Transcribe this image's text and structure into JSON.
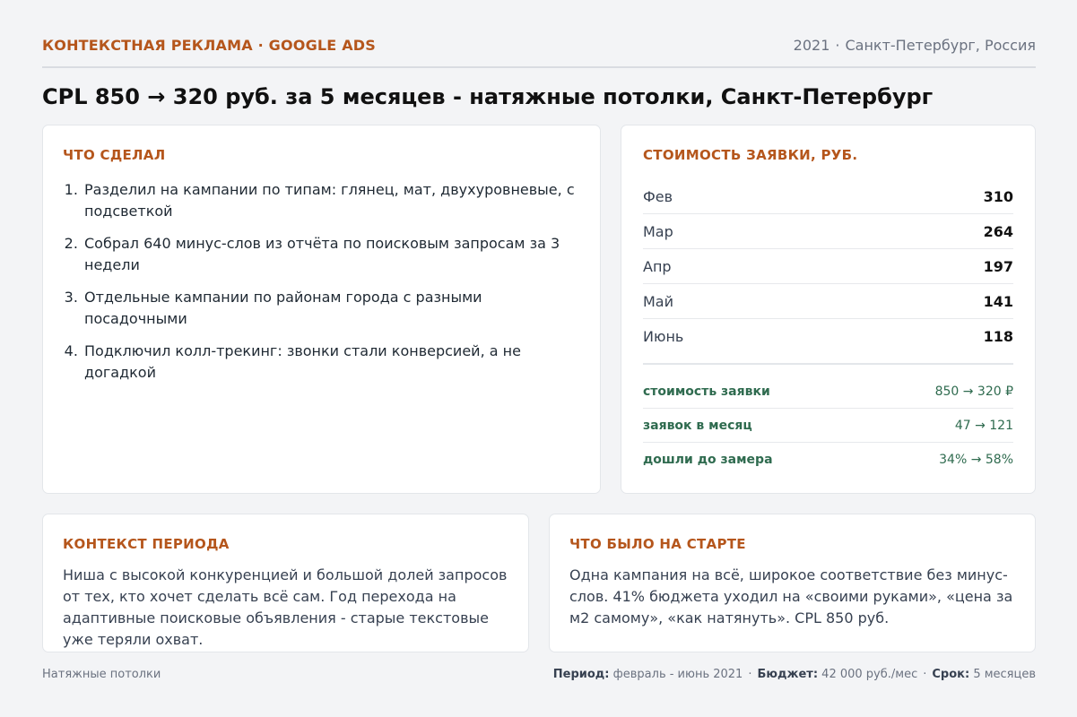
{
  "header": {
    "category": "КОНТЕКСТНАЯ РЕКЛАМА · GOOGLE ADS",
    "year": "2021",
    "location": "Санкт-Петербург, Россия"
  },
  "title": "CPL 850 → 320 руб. за 5 месяцев - натяжные потолки, Санкт-Петербург",
  "actions": {
    "title": "ЧТО СДЕЛАЛ",
    "items": [
      "Разделил на кампании по типам: глянец, мат, двухуровневые, с подсветкой",
      "Собрал 640 минус-слов из отчёта по поисковым запросам за 3 недели",
      "Отдельные кампании по районам города с разными посадочными",
      "Подключил колл-трекинг: звонки стали конверсией, а не догадкой"
    ]
  },
  "cpl": {
    "title": "СТОИМОСТЬ ЗАЯВКИ, РУБ.",
    "months": [
      {
        "month": "Фев",
        "value": "310"
      },
      {
        "month": "Мар",
        "value": "264"
      },
      {
        "month": "Апр",
        "value": "197"
      },
      {
        "month": "Май",
        "value": "141"
      },
      {
        "month": "Июнь",
        "value": "118"
      }
    ],
    "kpis": [
      {
        "label": "стоимость заявки",
        "value": "850 → 320 ₽"
      },
      {
        "label": "заявок в месяц",
        "value": "47 → 121"
      },
      {
        "label": "дошли до замера",
        "value": "34% → 58%"
      }
    ]
  },
  "context": {
    "title": "КОНТЕКСТ ПЕРИОДА",
    "text": "Ниша с высокой конкуренцией и большой долей запросов от тех, кто хочет сделать всё сам. Год перехода на адаптивные поисковые объявления - старые текстовые уже теряли охват."
  },
  "start": {
    "title": "ЧТО БЫЛО НА СТАРТЕ",
    "text": "Одна кампания на всё, широкое соответствие без минус-слов. 41% бюджета уходил на «своими руками», «цена за м2 самому», «как натянуть». CPL 850 руб."
  },
  "footer": {
    "niche": "Натяжные потолки",
    "period_label": "Период:",
    "period_value": "февраль - июнь 2021",
    "budget_label": "Бюджет:",
    "budget_value": "42 000 руб./мес",
    "term_label": "Срок:",
    "term_value": "5 месяцев"
  },
  "colors": {
    "accent": "#b5561c",
    "kpi": "#2f6b4f",
    "background": "#f3f4f6"
  }
}
